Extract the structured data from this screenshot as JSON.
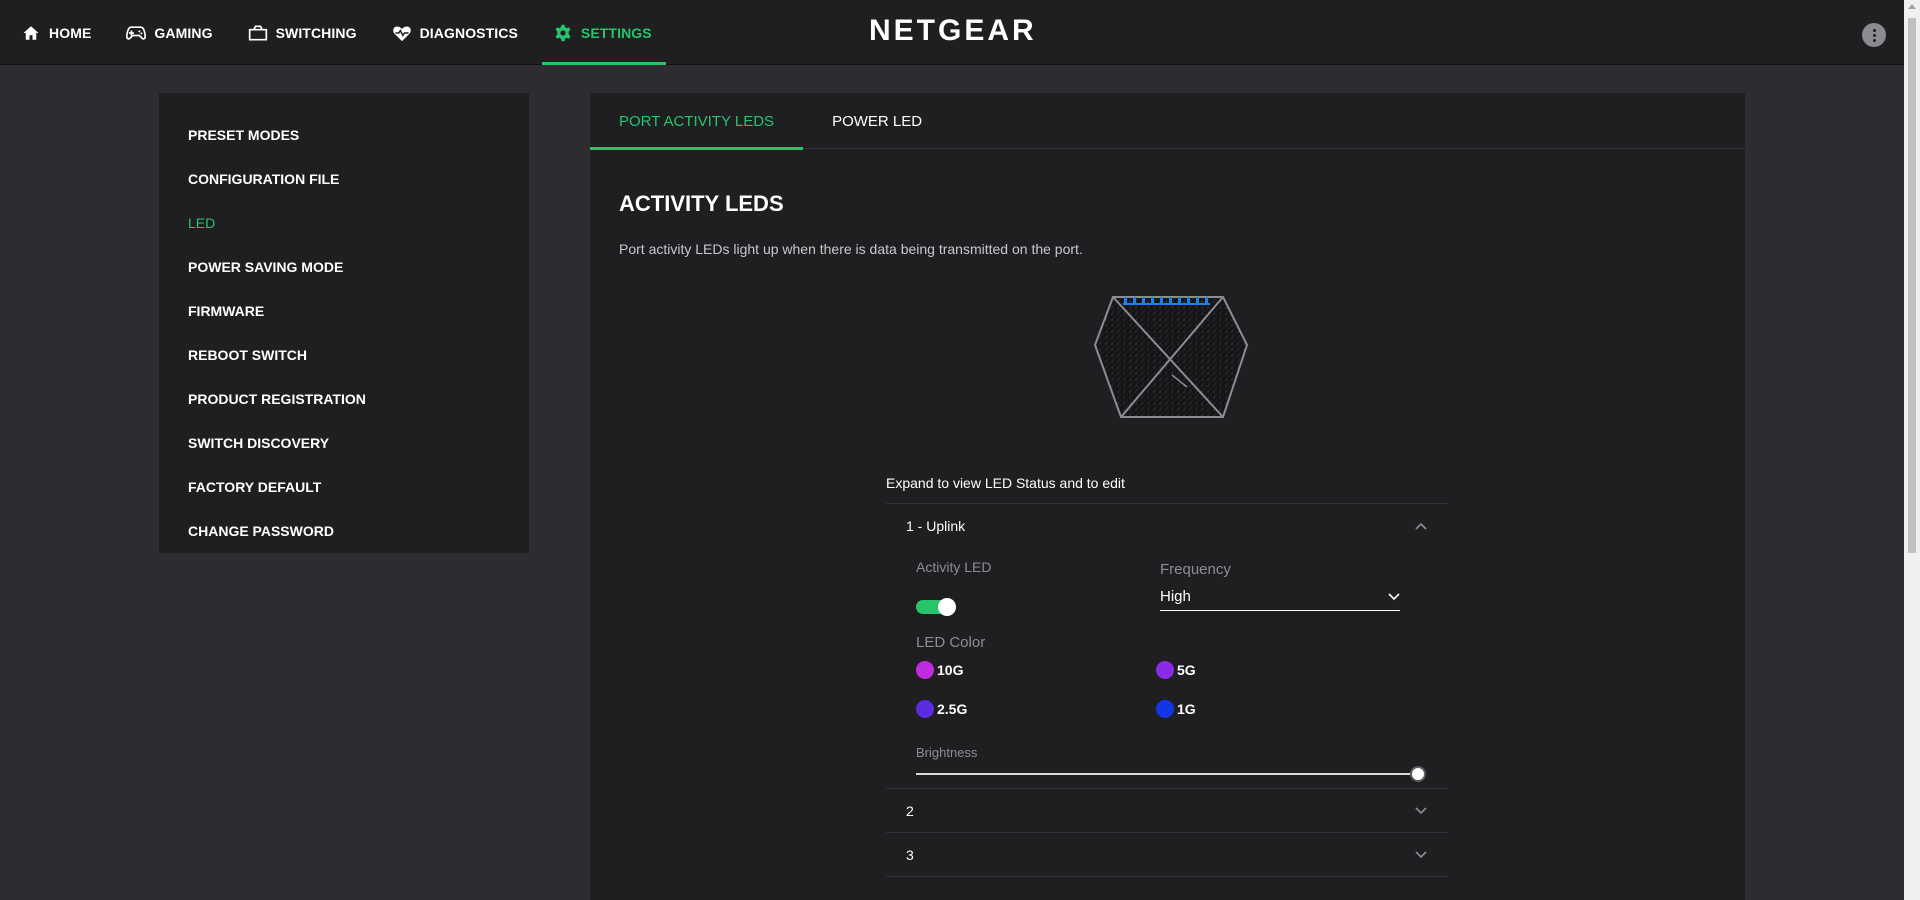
{
  "nav": {
    "items": [
      {
        "label": "HOME",
        "icon": "home-icon"
      },
      {
        "label": "GAMING",
        "icon": "gamepad-icon"
      },
      {
        "label": "SWITCHING",
        "icon": "switch-icon"
      },
      {
        "label": "DIAGNOSTICS",
        "icon": "heart-pulse-icon"
      },
      {
        "label": "SETTINGS",
        "icon": "gear-icon"
      }
    ],
    "active": "SETTINGS"
  },
  "brand": "NETGEAR",
  "sidebar": {
    "items": [
      {
        "label": "PRESET MODES"
      },
      {
        "label": "CONFIGURATION FILE"
      },
      {
        "label": "LED"
      },
      {
        "label": "POWER SAVING MODE"
      },
      {
        "label": "FIRMWARE"
      },
      {
        "label": "REBOOT SWITCH"
      },
      {
        "label": "PRODUCT REGISTRATION"
      },
      {
        "label": "SWITCH DISCOVERY"
      },
      {
        "label": "FACTORY DEFAULT"
      },
      {
        "label": "CHANGE PASSWORD"
      }
    ],
    "active": "LED"
  },
  "tabs": [
    {
      "label": "PORT ACTIVITY LEDS"
    },
    {
      "label": "POWER LED"
    }
  ],
  "section": {
    "title": "ACTIVITY LEDS",
    "description": "Port activity LEDs light up when there is data being transmitted on the port.",
    "expand_note": "Expand to view LED Status and to edit"
  },
  "ports": [
    {
      "label": "1 - Uplink",
      "expanded": true
    },
    {
      "label": "2",
      "expanded": false
    },
    {
      "label": "3",
      "expanded": false
    }
  ],
  "port1": {
    "activity_label": "Activity LED",
    "activity_on": true,
    "frequency_label": "Frequency",
    "frequency_value": "High",
    "color_label": "LED Color",
    "colors": [
      {
        "label": "10G",
        "color": "#c12be0"
      },
      {
        "label": "5G",
        "color": "#8a2be8"
      },
      {
        "label": "2.5G",
        "color": "#5b2ce0"
      },
      {
        "label": "1G",
        "color": "#1235e6"
      }
    ],
    "brightness_label": "Brightness",
    "brightness": 1.0
  },
  "colors": {
    "accent": "#27c46c",
    "topbar": "#1f1e21",
    "background": "#2f2c31"
  }
}
